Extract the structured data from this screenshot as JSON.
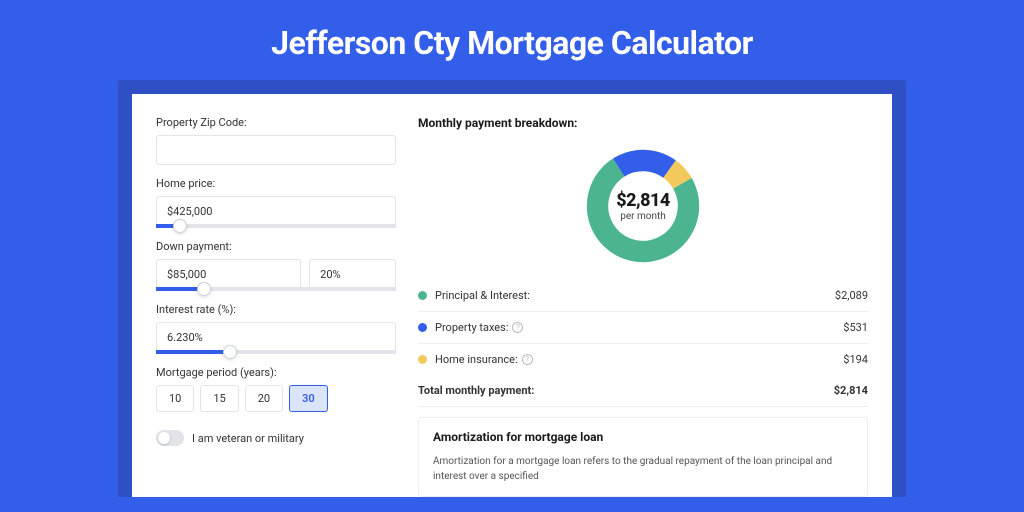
{
  "page_title": "Jefferson Cty Mortgage Calculator",
  "form": {
    "zip_label": "Property Zip Code:",
    "zip_value": "",
    "home_price_label": "Home price:",
    "home_price_value": "$425,000",
    "down_payment_label": "Down payment:",
    "down_payment_value": "$85,000",
    "down_payment_pct": "20%",
    "rate_label": "Interest rate (%):",
    "rate_value": "6.230%",
    "period_label": "Mortgage period (years):",
    "periods": [
      "10",
      "15",
      "20",
      "30"
    ],
    "period_selected": "30",
    "veteran_label": "I am veteran or military"
  },
  "breakdown": {
    "title": "Monthly payment breakdown:",
    "total_amount": "$2,814",
    "per_month": "per month",
    "rows": [
      {
        "label": "Principal & Interest:",
        "value": "$2,089",
        "color": "#4cb58f",
        "info": false
      },
      {
        "label": "Property taxes:",
        "value": "$531",
        "color": "#335eea",
        "info": true
      },
      {
        "label": "Home insurance:",
        "value": "$194",
        "color": "#f3c95b",
        "info": true
      }
    ],
    "total_label": "Total monthly payment:",
    "total_value": "$2,814"
  },
  "amortization": {
    "title": "Amortization for mortgage loan",
    "text": "Amortization for a mortgage loan refers to the gradual repayment of the loan principal and interest over a specified"
  },
  "chart_data": {
    "type": "pie",
    "title": "Monthly payment breakdown",
    "series": [
      {
        "name": "Principal & Interest",
        "value": 2089,
        "color": "#4cb58f"
      },
      {
        "name": "Property taxes",
        "value": 531,
        "color": "#335eea"
      },
      {
        "name": "Home insurance",
        "value": 194,
        "color": "#f3c95b"
      }
    ],
    "total": 2814,
    "center_label": "$2,814",
    "center_sub": "per month"
  }
}
